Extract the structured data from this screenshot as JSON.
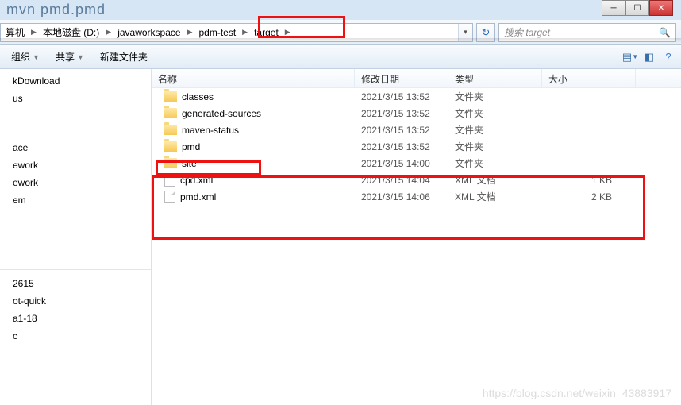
{
  "title_remnant": "mvn pmd.pmd",
  "breadcrumb": {
    "items": [
      "算机",
      "本地磁盘 (D:)",
      "javaworkspace",
      "pdm-test",
      "target"
    ]
  },
  "search": {
    "placeholder": "搜索 target"
  },
  "toolbar": {
    "organize": "组织",
    "share": "共享",
    "newfolder": "新建文件夹"
  },
  "nav": {
    "group1": [
      "kDownload",
      "us"
    ],
    "group2": [
      "ace",
      "ework",
      "ework",
      "em"
    ],
    "group3": [
      "2615",
      "ot-quick",
      "a1-18",
      "c"
    ]
  },
  "columns": {
    "name": "名称",
    "date": "修改日期",
    "type": "类型",
    "size": "大小"
  },
  "files": [
    {
      "icon": "folder",
      "name": "classes",
      "date": "2021/3/15 13:52",
      "type": "文件夹",
      "size": ""
    },
    {
      "icon": "folder",
      "name": "generated-sources",
      "date": "2021/3/15 13:52",
      "type": "文件夹",
      "size": ""
    },
    {
      "icon": "folder",
      "name": "maven-status",
      "date": "2021/3/15 13:52",
      "type": "文件夹",
      "size": ""
    },
    {
      "icon": "folder",
      "name": "pmd",
      "date": "2021/3/15 13:52",
      "type": "文件夹",
      "size": ""
    },
    {
      "icon": "folder",
      "name": "site",
      "date": "2021/3/15 14:00",
      "type": "文件夹",
      "size": ""
    },
    {
      "icon": "file",
      "name": "cpd.xml",
      "date": "2021/3/15 14:04",
      "type": "XML 文档",
      "size": "1 KB"
    },
    {
      "icon": "file",
      "name": "pmd.xml",
      "date": "2021/3/15 14:06",
      "type": "XML 文档",
      "size": "2 KB"
    }
  ],
  "watermark": "https://blog.csdn.net/weixin_43883917"
}
